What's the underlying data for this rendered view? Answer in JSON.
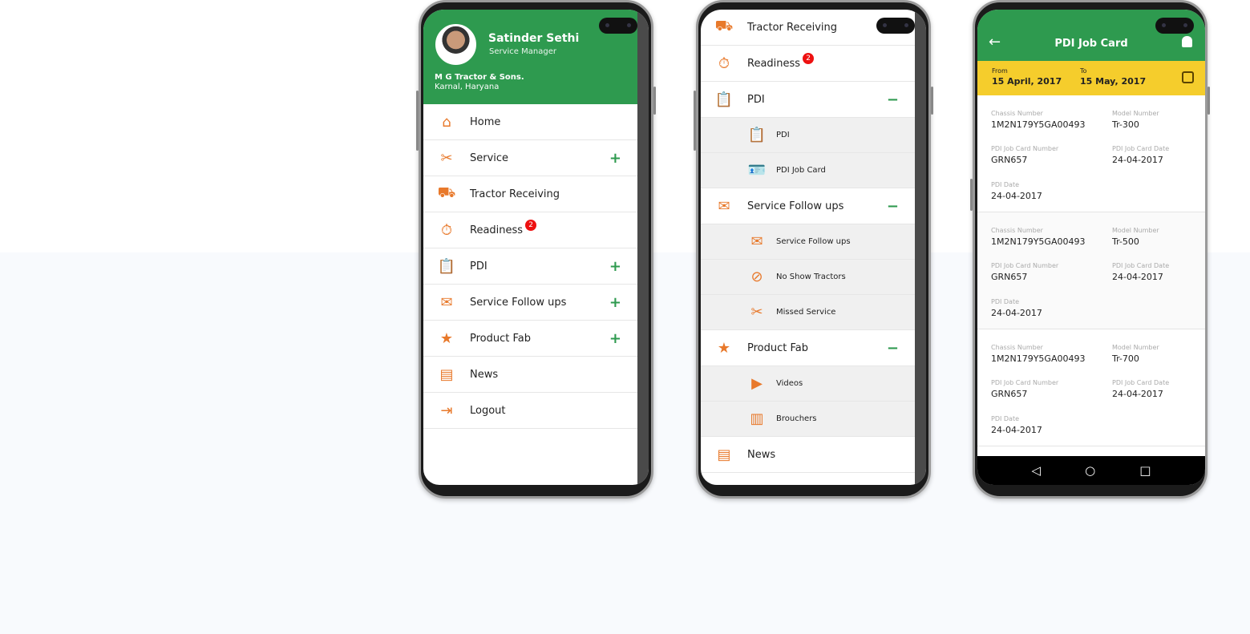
{
  "phone1": {
    "profile": {
      "name": "Satinder Sethi",
      "role": "Service Manager",
      "dealer": "M G Tractor & Sons.",
      "location": "Karnal, Haryana"
    },
    "menu": [
      {
        "label": "Home",
        "icon": "home-icon",
        "expand": ""
      },
      {
        "label": "Service",
        "icon": "tools-icon",
        "expand": "+"
      },
      {
        "label": "Tractor Receiving",
        "icon": "tractor-icon",
        "expand": ""
      },
      {
        "label": "Readiness",
        "icon": "stopwatch-icon",
        "expand": "",
        "badge": "2"
      },
      {
        "label": "PDI",
        "icon": "clipboard-icon",
        "expand": "+"
      },
      {
        "label": "Service Follow ups",
        "icon": "envelope-icon",
        "expand": "+"
      },
      {
        "label": "Product Fab",
        "icon": "star-bookmark-icon",
        "expand": "+"
      },
      {
        "label": "News",
        "icon": "newspaper-icon",
        "expand": ""
      },
      {
        "label": "Logout",
        "icon": "logout-icon",
        "expand": ""
      }
    ]
  },
  "phone2": {
    "items": [
      {
        "label": "Tractor Receiving"
      },
      {
        "label": "Readiness",
        "badge": "2"
      },
      {
        "label": "PDI",
        "collapse": "−",
        "children": [
          "PDI",
          "PDI Job Card"
        ]
      },
      {
        "label": "Service Follow ups",
        "collapse": "−",
        "children": [
          "Service Follow ups",
          "No Show Tractors",
          "Missed Service"
        ]
      },
      {
        "label": "Product Fab",
        "collapse": "−",
        "children": [
          "Videos",
          "Brouchers"
        ]
      },
      {
        "label": "News"
      }
    ]
  },
  "phone3": {
    "title": "PDI Job Card",
    "from_label": "From",
    "from_value": "15 April, 2017",
    "to_label": "To",
    "to_value": "15 May, 2017",
    "labels": {
      "chassis": "Chassis Number",
      "model": "Model Number",
      "job_no": "PDI Job Card Number",
      "job_date": "PDI Job Card Date",
      "pdi_date": "PDI Date"
    },
    "cards": [
      {
        "chassis": "1M2N179Y5GA00493",
        "model": "Tr-300",
        "job_no": "GRN657",
        "job_date": "24-04-2017",
        "pdi_date": "24-04-2017"
      },
      {
        "chassis": "1M2N179Y5GA00493",
        "model": "Tr-500",
        "job_no": "GRN657",
        "job_date": "24-04-2017",
        "pdi_date": "24-04-2017"
      },
      {
        "chassis": "1M2N179Y5GA00493",
        "model": "Tr-700",
        "job_no": "GRN657",
        "job_date": "24-04-2017",
        "pdi_date": "24-04-2017"
      }
    ]
  },
  "colors": {
    "primary": "#2e9a4f",
    "accent": "#e8792b",
    "date_bar": "#f5cd2c",
    "badge": "#e11111"
  }
}
